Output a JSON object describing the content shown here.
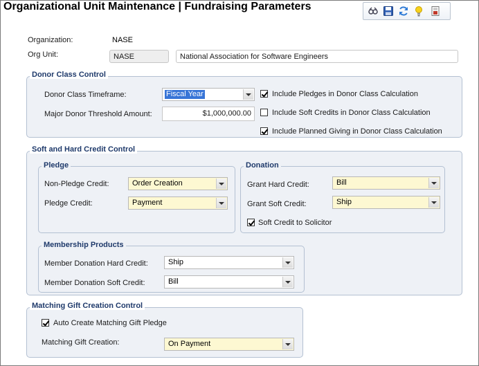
{
  "header": {
    "title": "Organizational Unit Maintenance | Fundraising Parameters",
    "toolbar": [
      {
        "name": "search-icon"
      },
      {
        "name": "save-icon"
      },
      {
        "name": "refresh-icon"
      },
      {
        "name": "lightbulb-icon"
      },
      {
        "name": "report-icon"
      }
    ]
  },
  "org": {
    "organization_label": "Organization:",
    "organization_value": "NASE",
    "org_unit_label": "Org Unit:",
    "org_unit_code": "NASE",
    "org_unit_name": "National Association for Software Engineers"
  },
  "donor_class": {
    "title": "Donor Class Control",
    "timeframe_label": "Donor Class Timeframe:",
    "timeframe_value": "Fiscal Year",
    "threshold_label": "Major Donor Threshold Amount:",
    "threshold_value": "$1,000,000.00",
    "checks": [
      {
        "label": "Include Pledges in Donor Class Calculation",
        "checked": true
      },
      {
        "label": "Include Soft Credits in Donor Class Calculation",
        "checked": false
      },
      {
        "label": "Include Planned Giving in Donor Class Calculation",
        "checked": true
      }
    ]
  },
  "credit_control": {
    "title": "Soft and Hard Credit Control",
    "pledge": {
      "title": "Pledge",
      "non_pledge_label": "Non-Pledge Credit:",
      "non_pledge_value": "Order Creation",
      "pledge_label": "Pledge Credit:",
      "pledge_value": "Payment"
    },
    "donation": {
      "title": "Donation",
      "grant_hard_label": "Grant Hard Credit:",
      "grant_hard_value": "Bill",
      "grant_soft_label": "Grant Soft Credit:",
      "grant_soft_value": "Ship",
      "soft_to_solicitor_label": "Soft Credit to Solicitor",
      "soft_to_solicitor_checked": true
    },
    "membership": {
      "title": "Membership Products",
      "hard_label": "Member Donation Hard Credit:",
      "hard_value": "Ship",
      "soft_label": "Member Donation Soft Credit:",
      "soft_value": "Bill"
    }
  },
  "matching": {
    "title": "Matching Gift Creation Control",
    "auto_create_label": "Auto Create Matching Gift Pledge",
    "auto_create_checked": true,
    "creation_label": "Matching Gift Creation:",
    "creation_value": "On Payment"
  },
  "colors": {
    "group_border": "#b3c0d2",
    "group_fill": "#eef1f6",
    "group_title": "#1f3a6b",
    "required_field": "#fdf8d2",
    "selection": "#3875d7"
  }
}
